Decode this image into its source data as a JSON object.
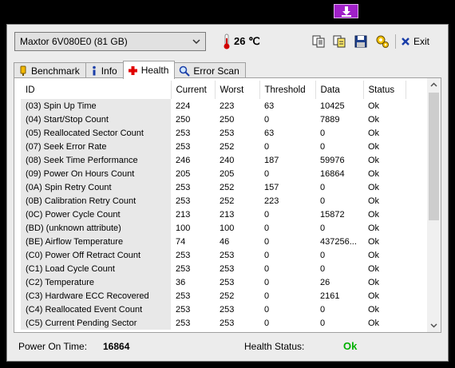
{
  "toolbar": {
    "drive": "Maxtor 6V080E0 (81 GB)",
    "temperature": "26 ℃",
    "exit_label": "Exit",
    "icons": [
      "copy-icon",
      "copy-all-icon",
      "save-icon",
      "settings-icon",
      "exit-icon"
    ]
  },
  "tabs": [
    {
      "label": "Benchmark",
      "icon": "benchmark-icon"
    },
    {
      "label": "Info",
      "icon": "info-icon"
    },
    {
      "label": "Health",
      "icon": "health-icon",
      "active": true
    },
    {
      "label": "Error Scan",
      "icon": "error-scan-icon"
    }
  ],
  "table": {
    "headers": [
      "ID",
      "Current",
      "Worst",
      "Threshold",
      "Data",
      "Status"
    ],
    "rows": [
      [
        "(03) Spin Up Time",
        "224",
        "223",
        "63",
        "10425",
        "Ok"
      ],
      [
        "(04) Start/Stop Count",
        "250",
        "250",
        "0",
        "7889",
        "Ok"
      ],
      [
        "(05) Reallocated Sector Count",
        "253",
        "253",
        "63",
        "0",
        "Ok"
      ],
      [
        "(07) Seek Error Rate",
        "253",
        "252",
        "0",
        "0",
        "Ok"
      ],
      [
        "(08) Seek Time Performance",
        "246",
        "240",
        "187",
        "59976",
        "Ok"
      ],
      [
        "(09) Power On Hours Count",
        "205",
        "205",
        "0",
        "16864",
        "Ok"
      ],
      [
        "(0A) Spin Retry Count",
        "253",
        "252",
        "157",
        "0",
        "Ok"
      ],
      [
        "(0B) Calibration Retry Count",
        "253",
        "252",
        "223",
        "0",
        "Ok"
      ],
      [
        "(0C) Power Cycle Count",
        "213",
        "213",
        "0",
        "15872",
        "Ok"
      ],
      [
        "(BD) (unknown attribute)",
        "100",
        "100",
        "0",
        "0",
        "Ok"
      ],
      [
        "(BE) Airflow Temperature",
        "74",
        "46",
        "0",
        "437256...",
        "Ok"
      ],
      [
        "(C0) Power Off Retract Count",
        "253",
        "253",
        "0",
        "0",
        "Ok"
      ],
      [
        "(C1) Load Cycle Count",
        "253",
        "253",
        "0",
        "0",
        "Ok"
      ],
      [
        "(C2) Temperature",
        "36",
        "253",
        "0",
        "26",
        "Ok"
      ],
      [
        "(C3) Hardware ECC Recovered",
        "253",
        "252",
        "0",
        "2161",
        "Ok"
      ],
      [
        "(C4) Reallocated Event Count",
        "253",
        "253",
        "0",
        "0",
        "Ok"
      ],
      [
        "(C5) Current Pending Sector",
        "253",
        "253",
        "0",
        "0",
        "Ok"
      ]
    ]
  },
  "status": {
    "power_on_label": "Power On Time:",
    "power_on_value": "16864",
    "health_label": "Health Status:",
    "health_value": "Ok",
    "health_color": "#00b000"
  }
}
